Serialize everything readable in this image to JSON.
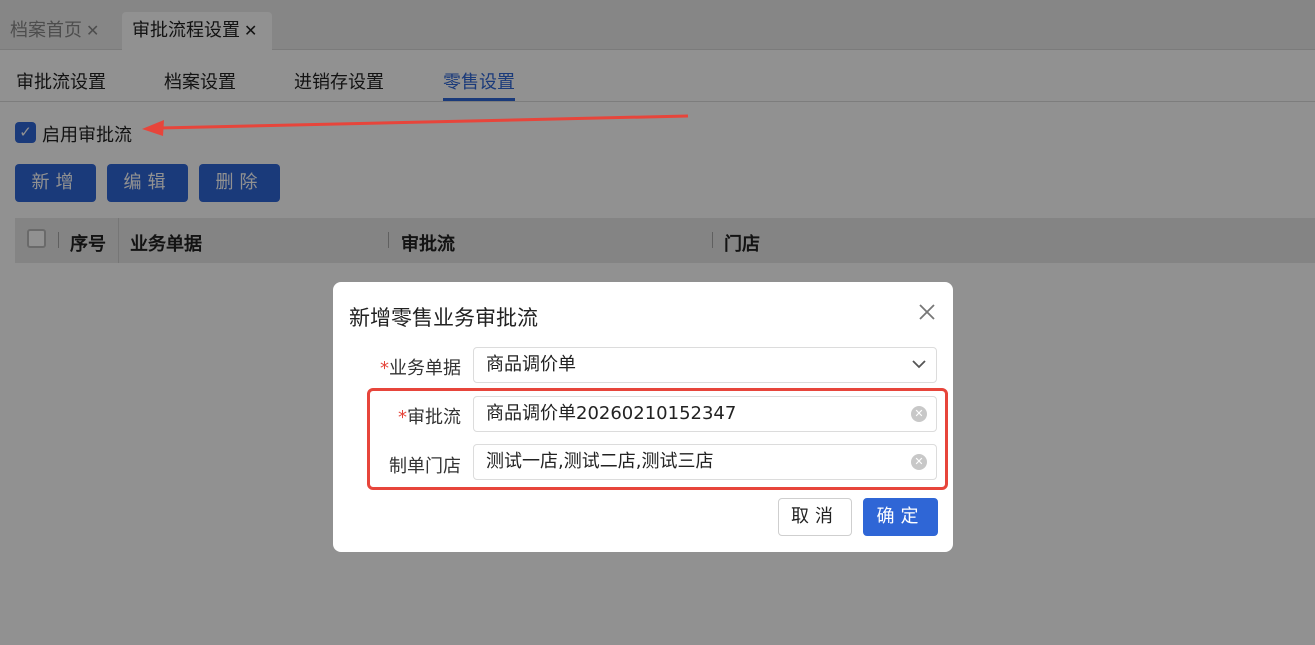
{
  "tabs": [
    {
      "label": "档案首页",
      "close": "✕"
    },
    {
      "label": "审批流程设置",
      "close": "✕"
    }
  ],
  "subtabs": [
    "审批流设置",
    "档案设置",
    "进销存设置",
    "零售设置"
  ],
  "enable_label": "启用审批流",
  "toolbar": {
    "add": "新增",
    "edit": "编辑",
    "delete": "删除"
  },
  "table": {
    "columns": [
      "序号",
      "业务单据",
      "审批流",
      "门店"
    ]
  },
  "dialog": {
    "title": "新增零售业务审批流",
    "fields": {
      "document": {
        "label": "业务单据",
        "value": "商品调价单"
      },
      "flow": {
        "label": "审批流",
        "value": "商品调价单20260210152347"
      },
      "store": {
        "label": "制单门店",
        "value": "测试一店,测试二店,测试三店"
      }
    },
    "required_mark": "*",
    "cancel": "取消",
    "confirm": "确定"
  },
  "colors": {
    "primary": "#2f66d6",
    "annotation": "#e7453b"
  }
}
